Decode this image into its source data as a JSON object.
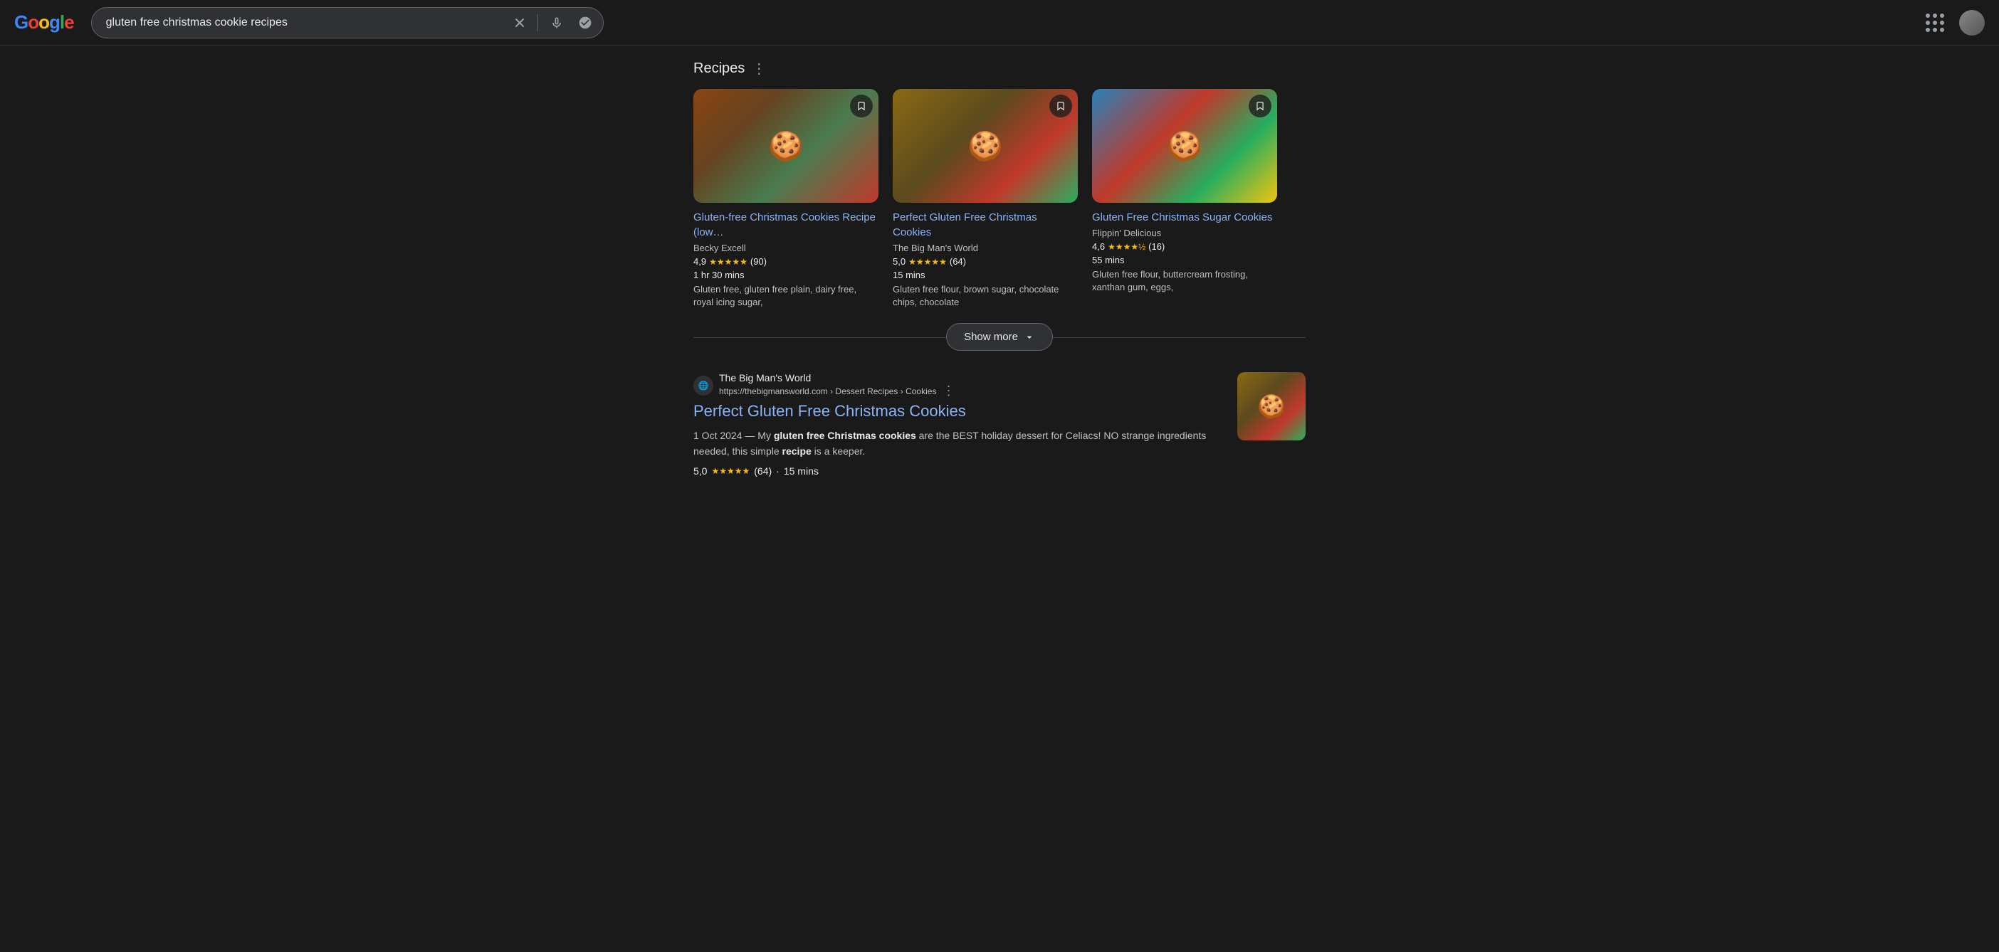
{
  "header": {
    "search_query": "gluten free christmas cookie recipes",
    "clear_label": "×",
    "apps_label": "Google apps",
    "voice_label": "Search by voice",
    "lens_label": "Search by image"
  },
  "recipes_section": {
    "title": "Recipes",
    "show_more_label": "Show more",
    "cards": [
      {
        "title": "Gluten-free Christmas Cookies Recipe (low…",
        "source": "Becky Excell",
        "rating": "4,9",
        "rating_count": "(90)",
        "time": "1 hr 30 mins",
        "ingredients": "Gluten free, gluten free plain, dairy free, royal icing sugar,",
        "stars": "★★★★★"
      },
      {
        "title": "Perfect Gluten Free Christmas Cookies",
        "source": "The Big Man's World",
        "rating": "5,0",
        "rating_count": "(64)",
        "time": "15 mins",
        "ingredients": "Gluten free flour, brown sugar, chocolate chips, chocolate",
        "stars": "★★★★★"
      },
      {
        "title": "Gluten Free Christmas Sugar Cookies",
        "source": "Flippin' Delicious",
        "rating": "4,6",
        "rating_count": "(16)",
        "time": "55 mins",
        "ingredients": "Gluten free flour, buttercream frosting, xanthan gum, eggs,",
        "stars": "★★★★½"
      }
    ]
  },
  "search_result": {
    "site_name": "The Big Man's World",
    "site_url": "https://thebigmansworld.com › Dessert Recipes › Cookies",
    "title": "Perfect Gluten Free Christmas Cookies",
    "date": "1 Oct 2024",
    "description_start": "— My ",
    "description_bold1": "gluten free Christmas cookies",
    "description_middle": " are the BEST holiday dessert for Celiacs! NO strange ingredients needed, this simple ",
    "description_bold2": "recipe",
    "description_end": " is a keeper.",
    "rating": "5,0",
    "stars": "★★★★★",
    "rating_count": "(64)",
    "dot": "·",
    "time": "15 mins"
  }
}
